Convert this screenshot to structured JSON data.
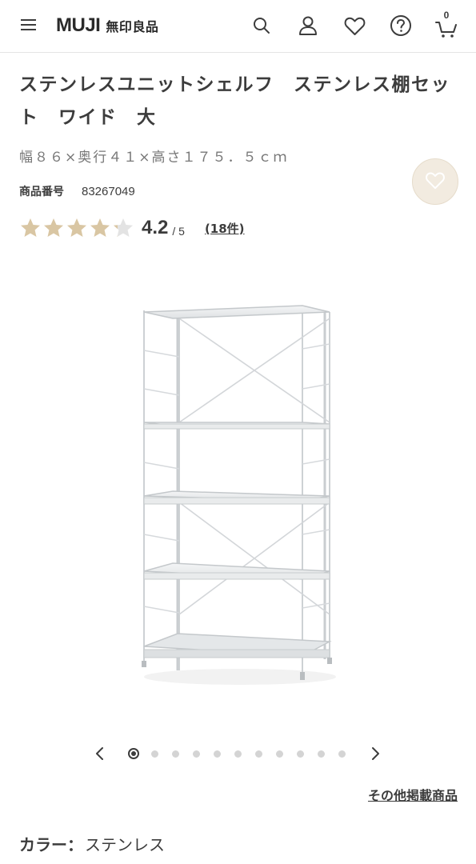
{
  "header": {
    "logo_latin": "MUJI",
    "logo_jp": "無印良品",
    "cart_count": "0"
  },
  "product": {
    "title": "ステンレスユニットシェルフ　ステンレス棚セット　ワイド　大",
    "dimensions": "幅８６×奥行４１×高さ１７５．５ｃｍ",
    "code_label": "商品番号",
    "code": "83267049",
    "rating": {
      "value": "4.2",
      "max": "/ 5",
      "stars_filled": 4.2,
      "review_count": "(18件)"
    }
  },
  "carousel": {
    "total_slides": 11,
    "active_index": 0
  },
  "links": {
    "other_products": "その他掲載商品"
  },
  "color": {
    "label": "カラー：",
    "value": "ステンレス"
  },
  "colors": {
    "star_filled": "#d9c6a3",
    "star_empty": "#e3e3e3",
    "fav_bg": "#f2ebe0",
    "text": "#3c3c3c"
  }
}
